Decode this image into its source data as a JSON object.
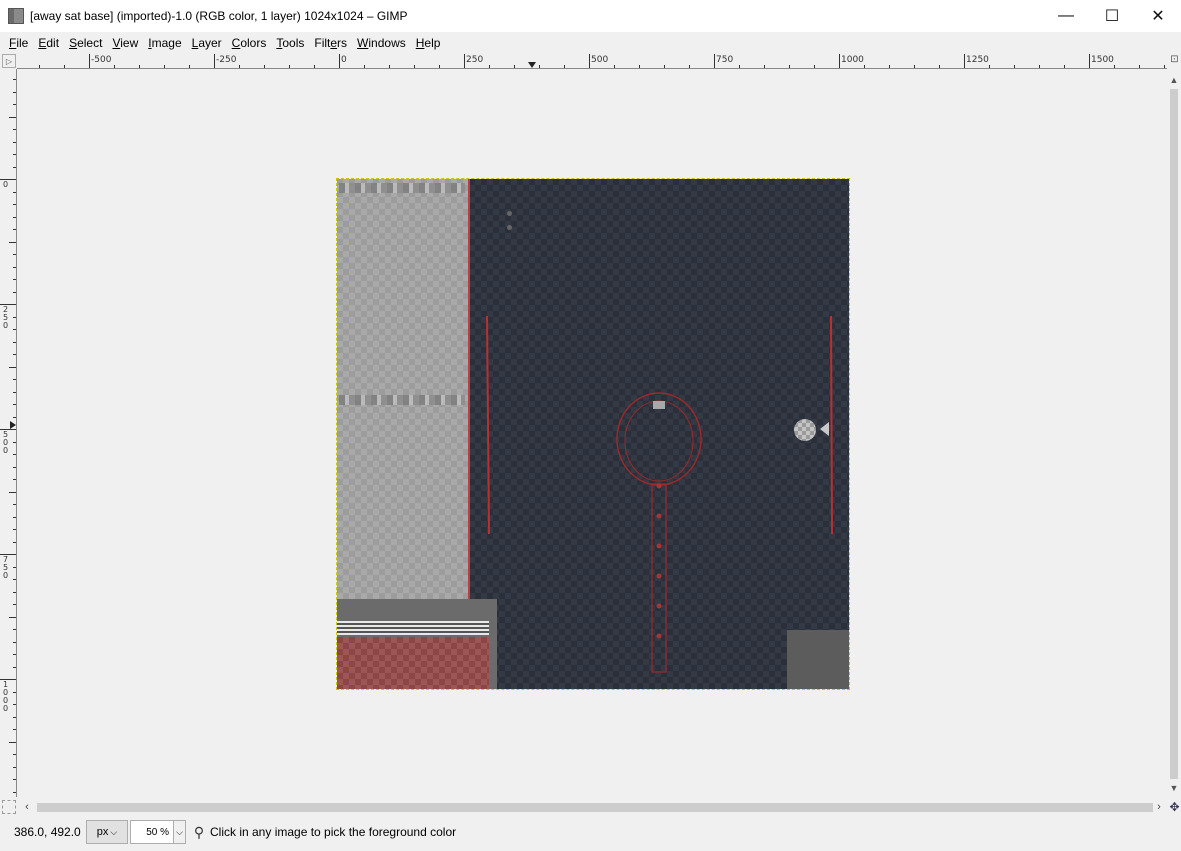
{
  "window": {
    "title": "[away sat base] (imported)-1.0 (RGB color, 1 layer) 1024x1024 – GIMP",
    "controls": {
      "minimize": "—",
      "maximize": "☐",
      "close": "✕"
    }
  },
  "menu": [
    {
      "label": "File"
    },
    {
      "label": "Edit"
    },
    {
      "label": "Select"
    },
    {
      "label": "View"
    },
    {
      "label": "Image"
    },
    {
      "label": "Layer"
    },
    {
      "label": "Colors"
    },
    {
      "label": "Tools"
    },
    {
      "label": "Filters"
    },
    {
      "label": "Windows"
    },
    {
      "label": "Help"
    }
  ],
  "rulers": {
    "horizontal_labels": [
      "-500",
      "-250",
      "0",
      "250",
      "500",
      "750",
      "1000",
      "1250",
      "1500"
    ],
    "vertical_labels": [
      "250",
      "0",
      "250",
      "500",
      "750",
      "1000"
    ]
  },
  "status": {
    "coordinates": "386.0, 492.0",
    "unit": "px",
    "zoom": "50 %",
    "message": "Click in any image to pick the foreground color"
  },
  "icons": {
    "app": "gimp-icon",
    "picker": "color-picker-icon",
    "navigate": "navigate-icon",
    "zoom_fit": "zoom-fit-icon",
    "quick_mask": "quick-mask-icon"
  }
}
